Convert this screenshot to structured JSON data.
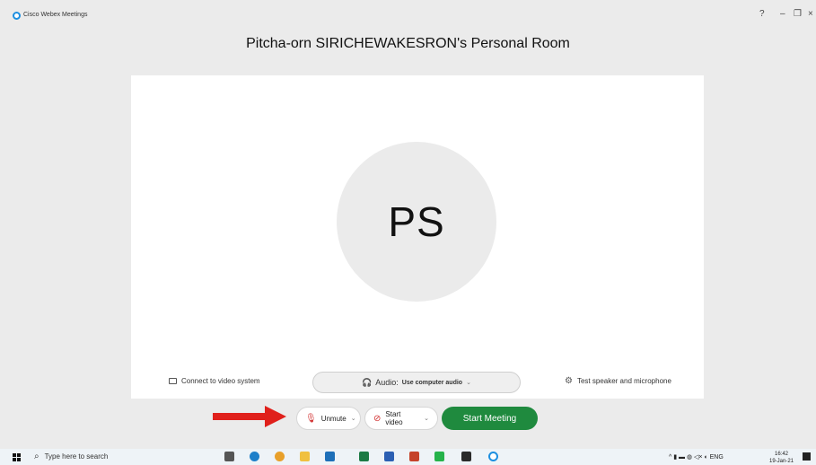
{
  "window": {
    "app_title": "Cisco Webex Meetings",
    "help_glyph": "?",
    "minimize_glyph": "–",
    "restore_glyph": "❐",
    "close_glyph": "×"
  },
  "room": {
    "title": "Pitcha-orn SIRICHEWAKESRON's Personal Room",
    "avatar_initials": "PS"
  },
  "options": {
    "connect_label": "Connect to video system",
    "audio_label": "Audio:",
    "audio_value": "Use computer audio",
    "audio_chevron": "⌄",
    "test_label": "Test speaker and microphone"
  },
  "controls": {
    "unmute_label": "Unmute",
    "start_video_label": "Start video",
    "start_meeting_label": "Start Meeting",
    "chevron": "⌄"
  },
  "annotation": {
    "arrow_color": "#e0201b"
  },
  "taskbar": {
    "search_placeholder": "Type here to search",
    "clock_time": "16:42",
    "clock_date": "19-Jan-21",
    "tray_text": "^ ▮ ▬ ◍ ◁× ◐ ENG"
  },
  "colors": {
    "accent_green": "#1f8a3e",
    "mute_red": "#d12e2e",
    "webex_blue": "#1d8fe0"
  }
}
